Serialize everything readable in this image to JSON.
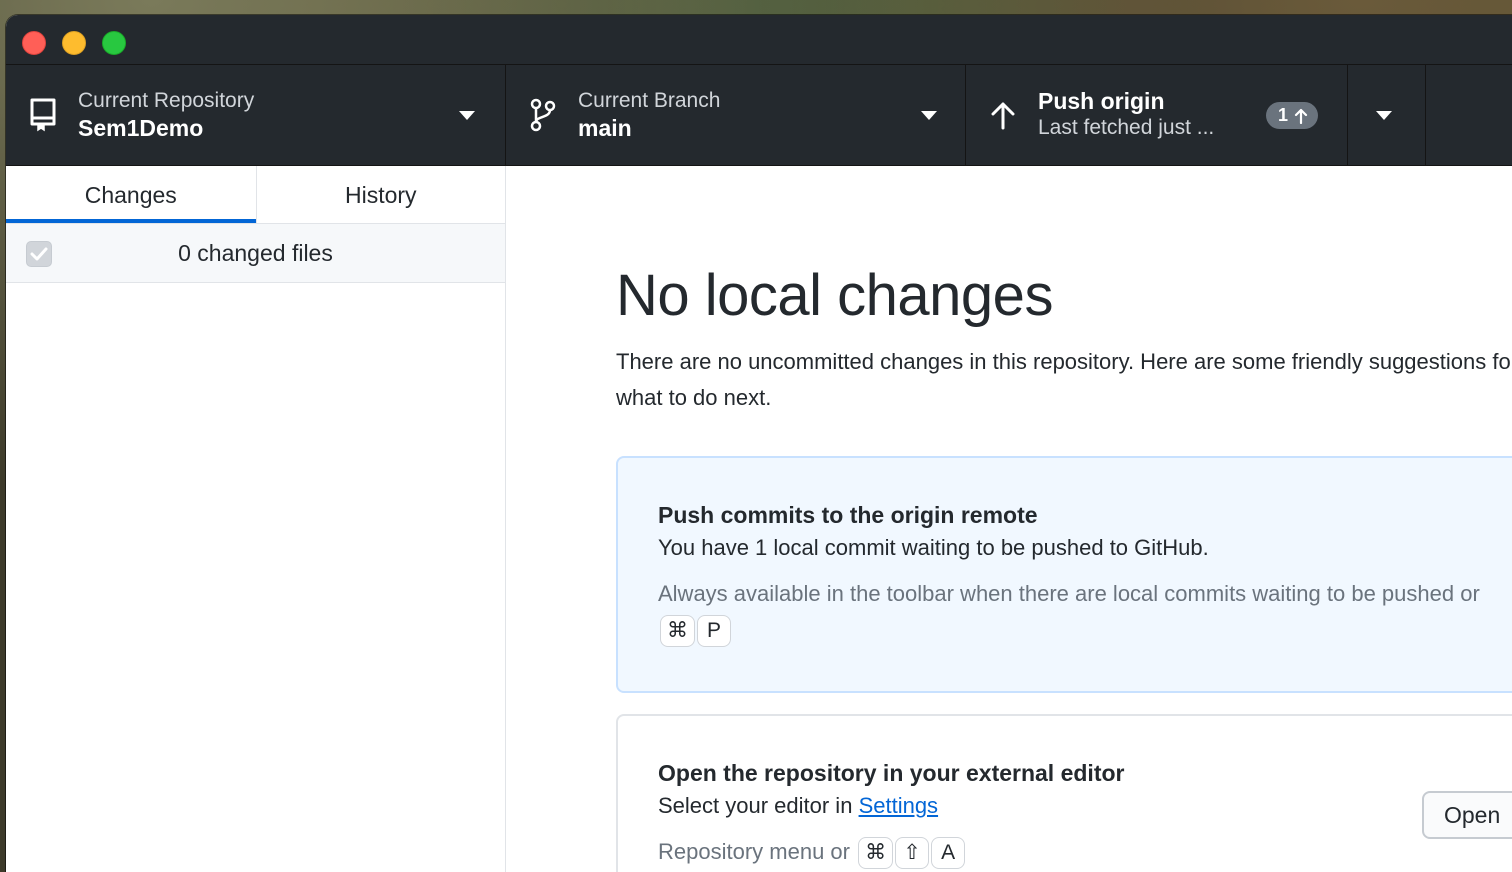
{
  "toolbar": {
    "repository": {
      "label": "Current Repository",
      "value": "Sem1Demo"
    },
    "branch": {
      "label": "Current Branch",
      "value": "main"
    },
    "push": {
      "title": "Push origin",
      "subtitle": "Last fetched just ...",
      "badge_count": "1"
    }
  },
  "sidebar": {
    "tabs": [
      {
        "label": "Changes",
        "active": true
      },
      {
        "label": "History",
        "active": false
      }
    ],
    "changes_summary": "0 changed files"
  },
  "main": {
    "title": "No local changes",
    "description": "There are no uncommitted changes in this repository. Here are some friendly suggestions for what to do next.",
    "cards": [
      {
        "title": "Push commits to the origin remote",
        "description": "You have 1 local commit waiting to be pushed to GitHub.",
        "hint": "Always available in the toolbar when there are local commits waiting to be pushed or",
        "shortcut": [
          "⌘",
          "P"
        ]
      },
      {
        "title": "Open the repository in your external editor",
        "description_prefix": "Select your editor in",
        "link": "Settings",
        "hint": "Repository menu or",
        "shortcut": [
          "⌘",
          "⇧",
          "A"
        ],
        "button": "Open"
      }
    ]
  },
  "colors": {
    "toolbar_bg": "#24292e",
    "accent": "#0366d6",
    "card_highlight_bg": "#f1f8ff"
  }
}
